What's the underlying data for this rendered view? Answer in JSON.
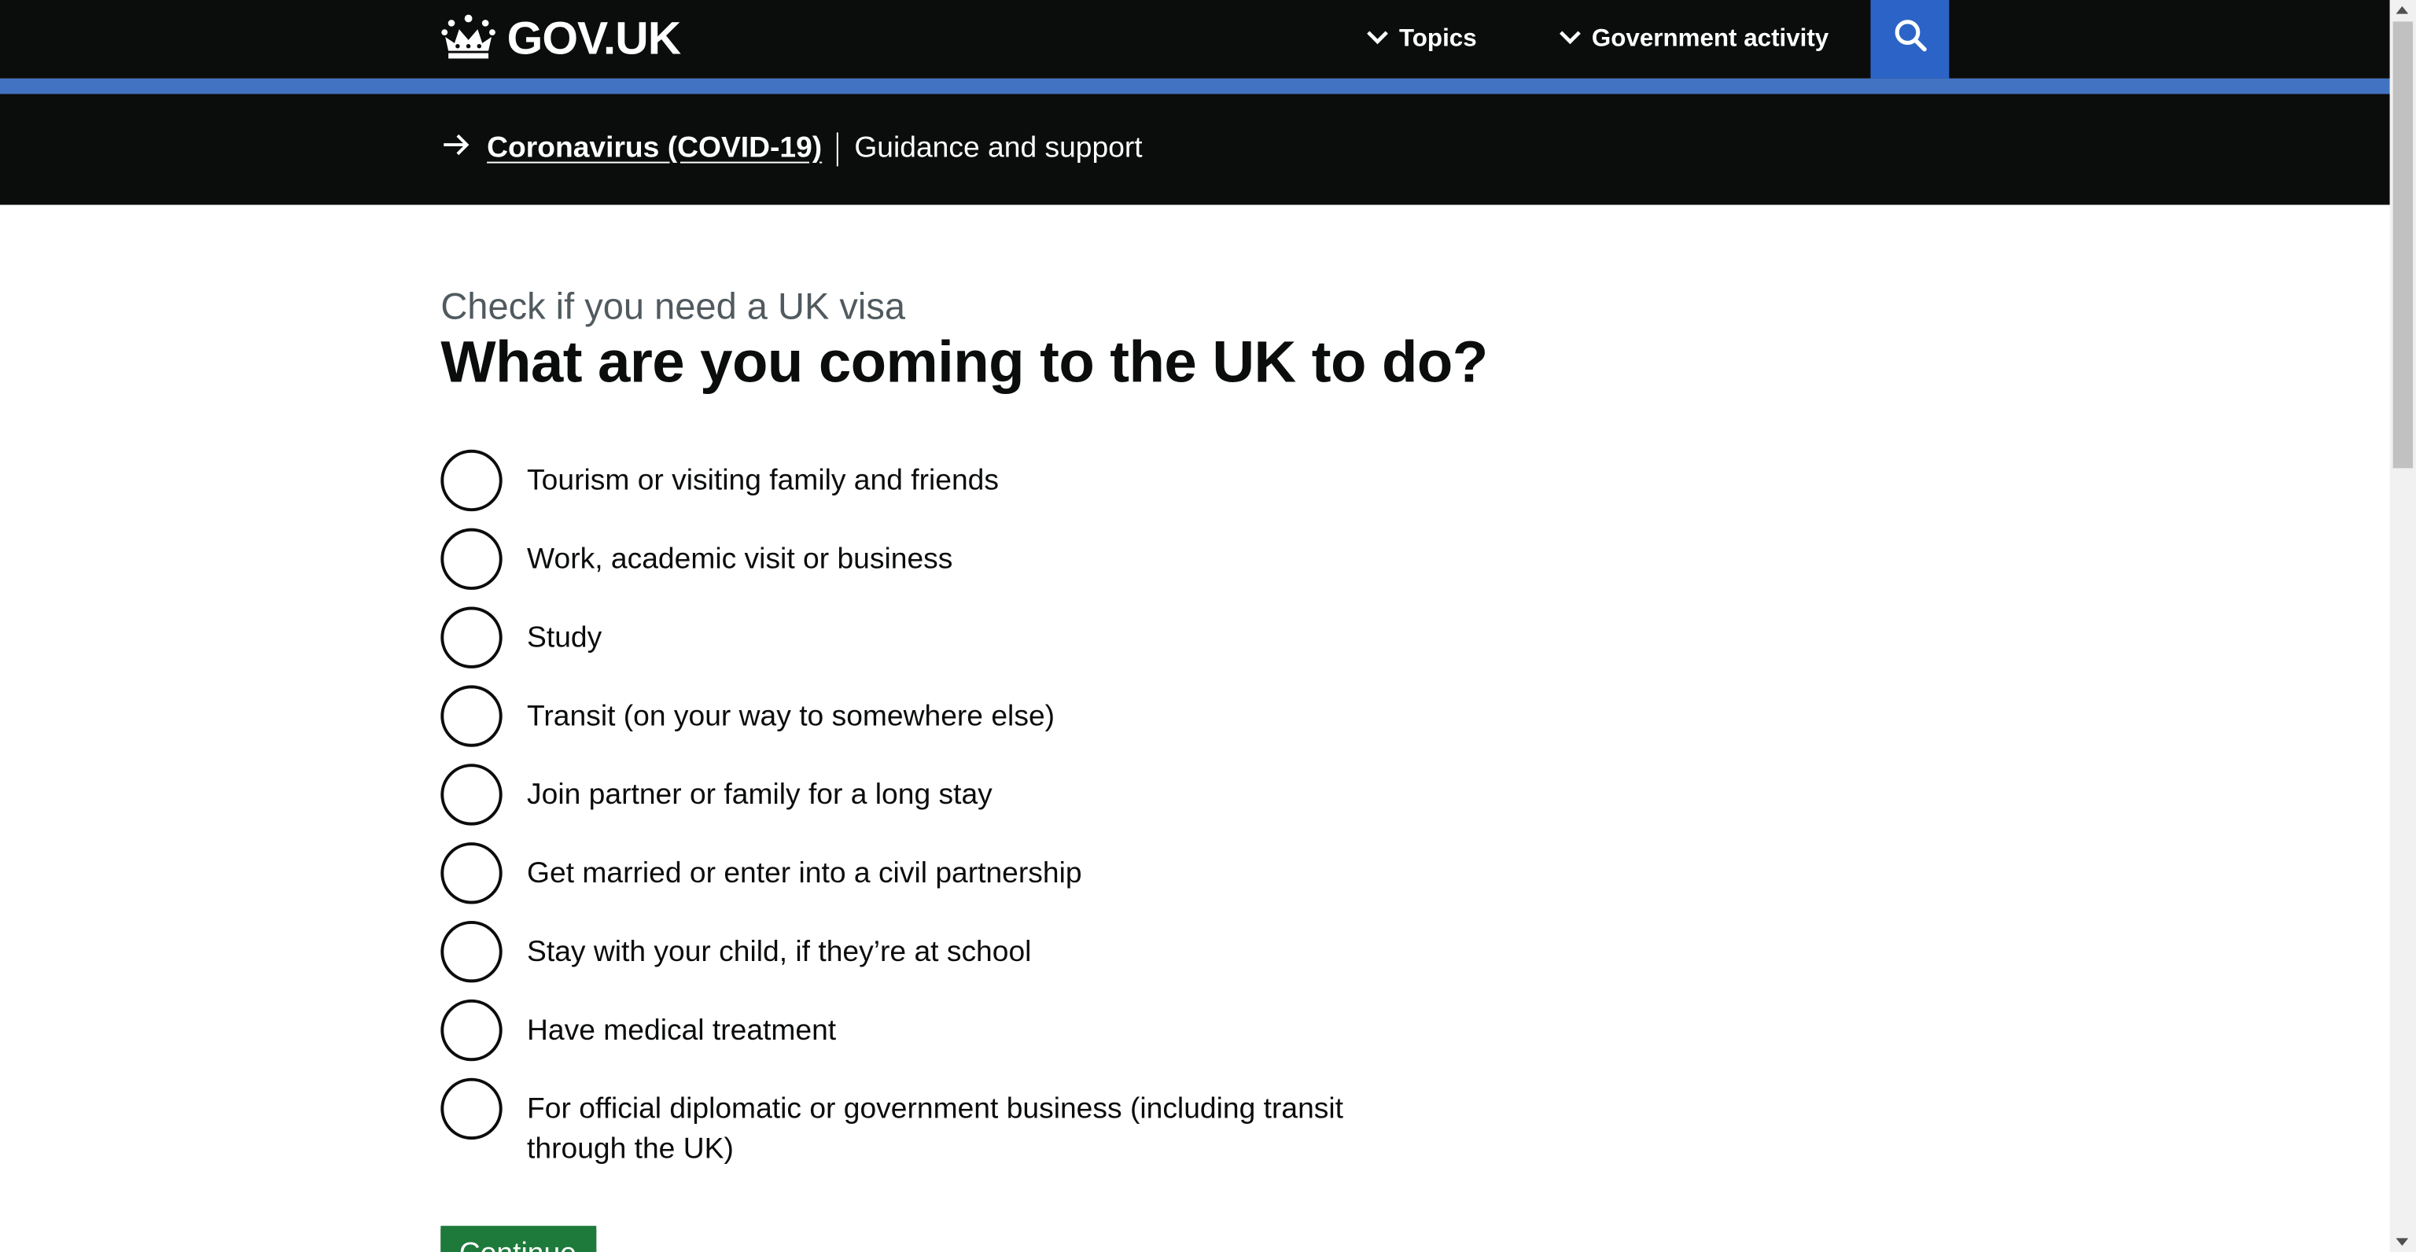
{
  "header": {
    "logo_text": "GOV.UK",
    "nav": [
      {
        "label": "Topics",
        "icon": "chevron-down-icon"
      },
      {
        "label": "Government activity",
        "icon": "chevron-down-icon"
      }
    ],
    "search_icon": "search-icon",
    "colors": {
      "header_bg": "#0b0c0c",
      "accent_bar": "#4273c3",
      "search_bg": "#2c63c6"
    }
  },
  "covid_banner": {
    "arrow_icon": "arrow-right-icon",
    "link": "Coronavirus (COVID-19)",
    "subtitle": "Guidance and support"
  },
  "form": {
    "caption": "Check if you need a UK visa",
    "question": "What are you coming to the UK to do?",
    "options": [
      {
        "label": "Tourism or visiting family and friends",
        "checked": false
      },
      {
        "label": "Work, academic visit or business",
        "checked": false
      },
      {
        "label": "Study",
        "checked": false
      },
      {
        "label": "Transit (on your way to somewhere else)",
        "checked": false
      },
      {
        "label": "Join partner or family for a long stay",
        "checked": false
      },
      {
        "label": "Get married or enter into a civil partnership",
        "checked": false
      },
      {
        "label": "Stay with your child, if they’re at school",
        "checked": false
      },
      {
        "label": "Have medical treatment",
        "checked": false
      },
      {
        "label": "For official diplomatic or government business (including transit through the UK)",
        "checked": false
      }
    ],
    "continue_label": "Continue",
    "colors": {
      "continue_bg": "#1e7a3b"
    }
  }
}
